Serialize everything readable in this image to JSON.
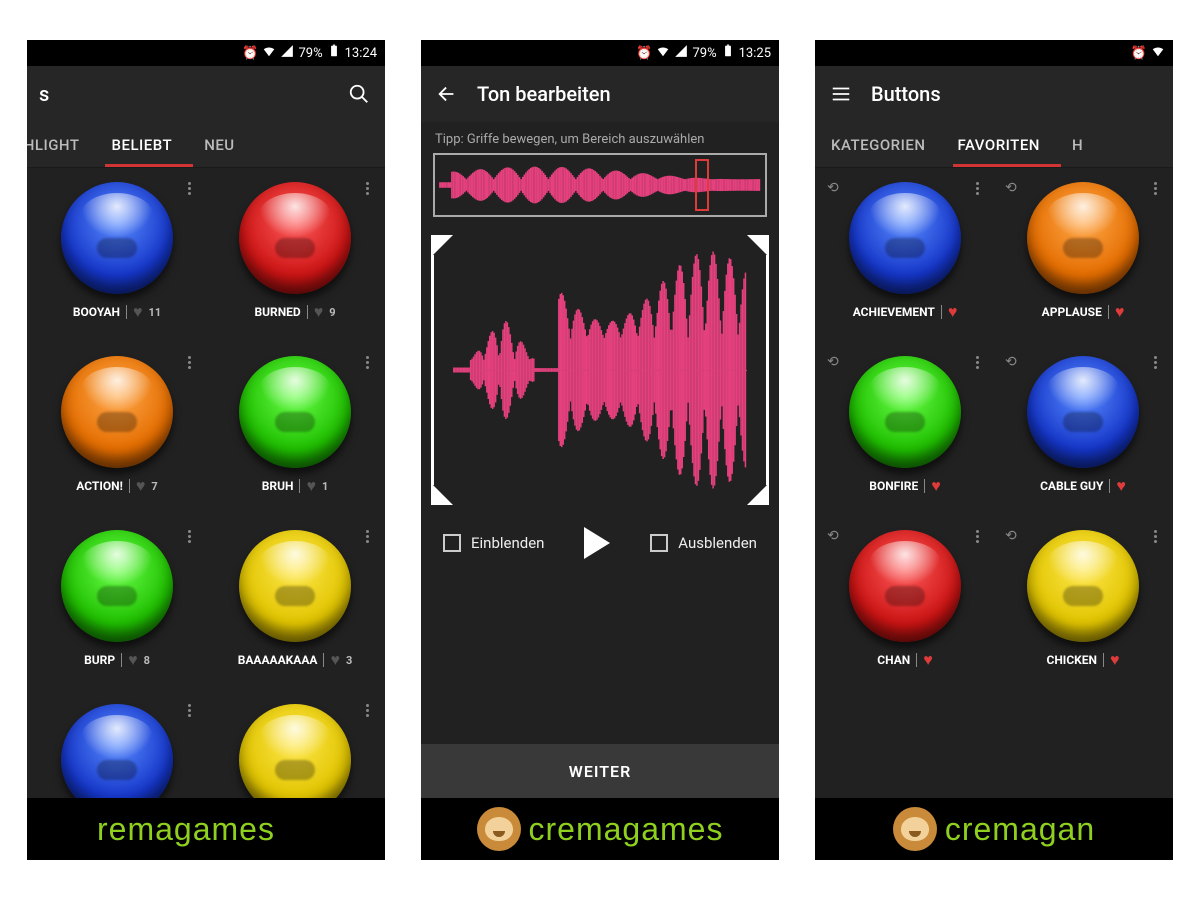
{
  "status": {
    "battery": "79%",
    "time1": "13:24",
    "time2": "13:25"
  },
  "brand": "cremagames",
  "screen1": {
    "title_fragment": "s",
    "tabs": [
      "GHLIGHT",
      "BELIEBT",
      "NEU"
    ],
    "active_tab": 1,
    "buttons": [
      {
        "label": "BOOYAH",
        "color": "blue",
        "likes": "11"
      },
      {
        "label": "BURNED",
        "color": "red",
        "likes": "9"
      },
      {
        "label": "ACTION!",
        "color": "orange",
        "likes": "7"
      },
      {
        "label": "BRUH",
        "color": "green",
        "likes": "1"
      },
      {
        "label": "BURP",
        "color": "green",
        "likes": "8"
      },
      {
        "label": "BAAAAAKAAA",
        "color": "yellow",
        "likes": "3"
      },
      {
        "label": "",
        "color": "blue",
        "likes": ""
      },
      {
        "label": "",
        "color": "yellow",
        "likes": ""
      }
    ]
  },
  "screen2": {
    "title": "Ton bearbeiten",
    "tip": "Tipp: Griffe bewegen, um Bereich auszuwählen",
    "fade_in": "Einblenden",
    "fade_out": "Ausblenden",
    "next": "WEITER"
  },
  "screen3": {
    "title": "Buttons",
    "tabs": [
      "KATEGORIEN",
      "FAVORITEN",
      "H"
    ],
    "active_tab": 1,
    "buttons": [
      {
        "label": "ACHIEVEMENT",
        "color": "blue"
      },
      {
        "label": "APPLAUSE",
        "color": "orange"
      },
      {
        "label": "BONFIRE",
        "color": "green"
      },
      {
        "label": "CABLE GUY",
        "color": "blue"
      },
      {
        "label": "CHAN",
        "color": "red"
      },
      {
        "label": "CHICKEN",
        "color": "yellow"
      }
    ]
  }
}
